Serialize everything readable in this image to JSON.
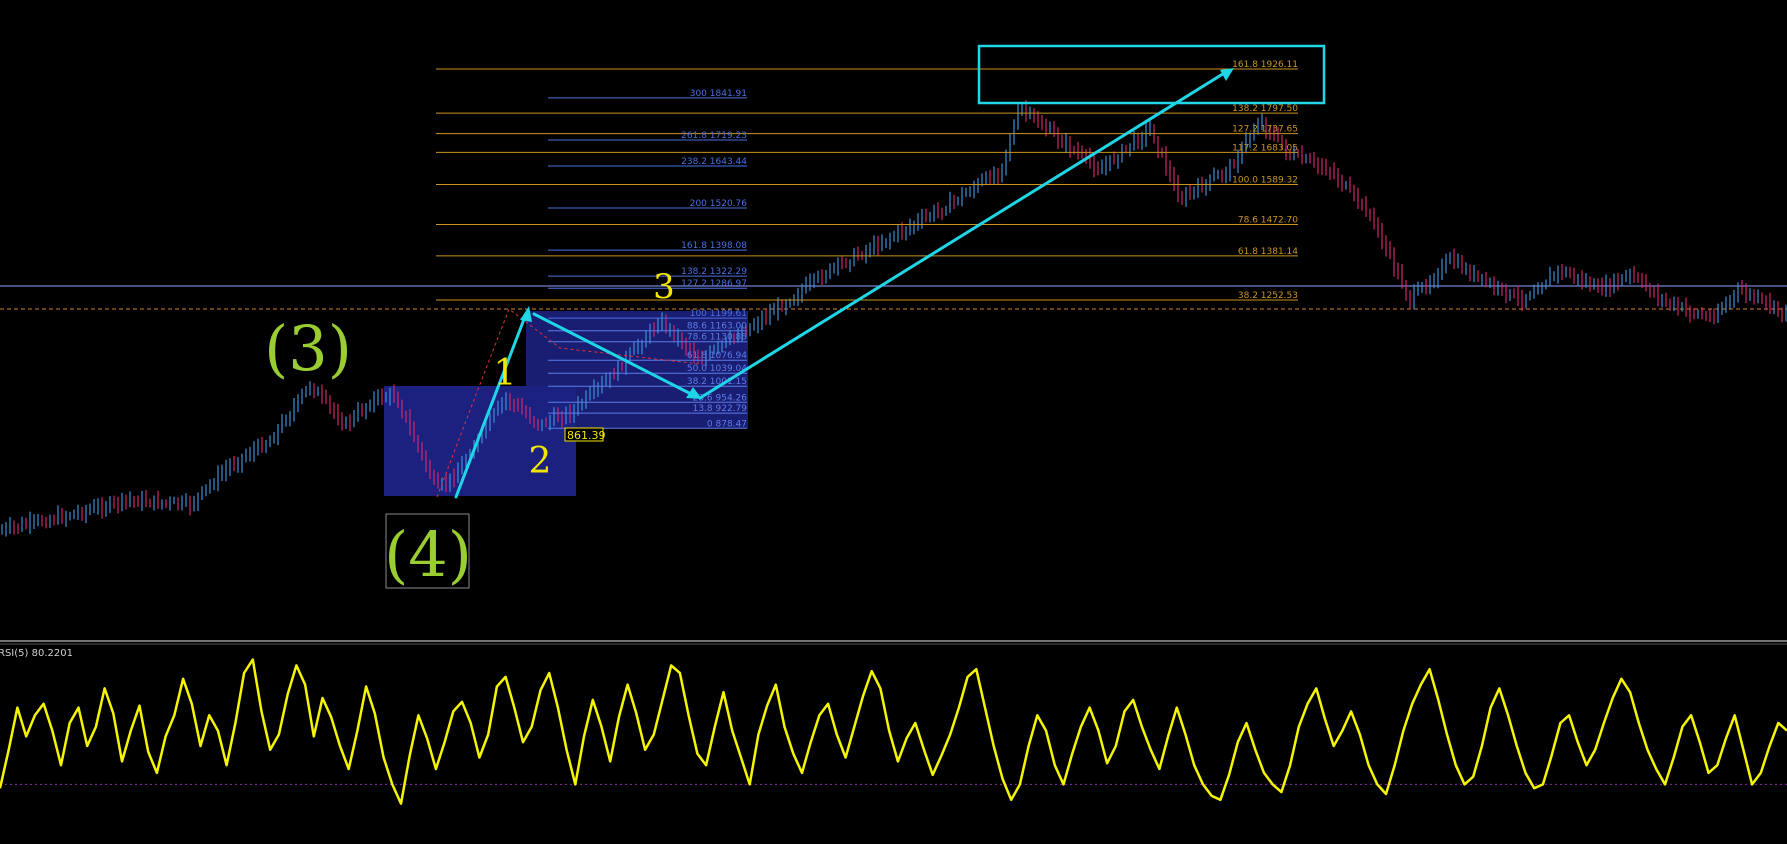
{
  "chart_data": {
    "type": "line",
    "title": "",
    "colors": {
      "background": "#000000",
      "bull_candle": "#3d8fd6",
      "bear_candle": "#d0266c",
      "fib_main": "#c9951e",
      "fib_ext": "#4b6fe0",
      "fib_retr": "#5c7be8",
      "cyan_arrows": "#1fd6e6",
      "wave_major": "#9acd32",
      "wave_minor": "#f2e600",
      "rsi_line": "#f5f500",
      "zone": "#1c2180"
    },
    "price_axis": {
      "visible": false,
      "ylim": [
        640,
        2040
      ]
    },
    "fib_main_levels": [
      {
        "label": "161.8 1926.11",
        "price": 1926.11
      },
      {
        "label": "138.2 1797.50",
        "price": 1797.5
      },
      {
        "label": "127.2 1737.65",
        "price": 1737.65
      },
      {
        "label": "117.2 1683.05",
        "price": 1683.05
      },
      {
        "label": "100.0   1589.32",
        "price": 1589.32
      },
      {
        "label": "78.6 1472.70",
        "price": 1472.7
      },
      {
        "label": "61.8 1381.14",
        "price": 1381.14
      },
      {
        "label": "38.2 1252.53",
        "price": 1252.53
      }
    ],
    "fib_ext_levels": [
      {
        "label": "300 1841.91",
        "price": 1841.91
      },
      {
        "label": "261.8 1719.23",
        "price": 1719.23
      },
      {
        "label": "238.2 1643.44",
        "price": 1643.44
      },
      {
        "label": "200 1520.76",
        "price": 1520.76
      },
      {
        "label": "161.8 1398.08",
        "price": 1398.08
      },
      {
        "label": "138.2 1322.29",
        "price": 1322.29
      },
      {
        "label": "127.2 1286.97",
        "price": 1286.97
      },
      {
        "label": "100 1199.61",
        "price": 1199.61
      }
    ],
    "fib_retr_levels": [
      {
        "label": "88.6 1163.00",
        "price": 1163.0
      },
      {
        "label": "78.6 1130.88",
        "price": 1130.88
      },
      {
        "label": "61.8 1076.94",
        "price": 1076.94
      },
      {
        "label": "50.0 1039.04",
        "price": 1039.04
      },
      {
        "label": "38.2 1001.15",
        "price": 1001.15
      },
      {
        "label": "23.6 954.26",
        "price": 954.26
      },
      {
        "label": "13.8 922.79",
        "price": 922.79
      },
      {
        "label": "0 878.47",
        "price": 878.47
      }
    ],
    "price_tag": "861.39",
    "wave_labels": [
      {
        "text": "(3)",
        "style": "major"
      },
      {
        "text": "(4)",
        "style": "major-boxed"
      },
      {
        "text": "1",
        "style": "minor"
      },
      {
        "text": "2",
        "style": "minor"
      },
      {
        "text": "3",
        "style": "minor"
      }
    ],
    "rsi": {
      "label": "RSI(5) 80.2201",
      "period": 5,
      "last_value": 80.2201,
      "ylim": [
        0,
        100
      ],
      "level": 30,
      "values": [
        28,
        48,
        70,
        55,
        66,
        72,
        58,
        40,
        62,
        70,
        50,
        60,
        80,
        67,
        42,
        58,
        71,
        47,
        36,
        55,
        66,
        85,
        72,
        50,
        66,
        58,
        40,
        62,
        88,
        95,
        68,
        48,
        56,
        77,
        92,
        82,
        55,
        75,
        65,
        50,
        38,
        58,
        81,
        67,
        44,
        30,
        20,
        45,
        66,
        54,
        38,
        52,
        68,
        73,
        62,
        44,
        56,
        81,
        86,
        70,
        52,
        60,
        79,
        88,
        70,
        48,
        30,
        55,
        74,
        60,
        42,
        65,
        82,
        67,
        48,
        56,
        74,
        92,
        88,
        66,
        46,
        40,
        60,
        78,
        58,
        44,
        30,
        56,
        71,
        82,
        60,
        46,
        36,
        52,
        66,
        72,
        56,
        44,
        60,
        76,
        89,
        80,
        58,
        42,
        54,
        62,
        48,
        35,
        45,
        56,
        70,
        86,
        90,
        70,
        50,
        33,
        22,
        30,
        50,
        66,
        58,
        40,
        30,
        46,
        60,
        70,
        58,
        41,
        50,
        68,
        74,
        60,
        48,
        38,
        55,
        70,
        56,
        40,
        30,
        24,
        22,
        35,
        52,
        62,
        48,
        36,
        30,
        26,
        40,
        60,
        72,
        80,
        64,
        50,
        58,
        68,
        56,
        40,
        30,
        25,
        40,
        58,
        72,
        82,
        90,
        74,
        56,
        40,
        30,
        34,
        50,
        70,
        80,
        66,
        50,
        36,
        28,
        30,
        45,
        62,
        66,
        52,
        40,
        48,
        62,
        75,
        85,
        78,
        62,
        48,
        38,
        30,
        44,
        60,
        66,
        52,
        36,
        40,
        54,
        66,
        48,
        30,
        36,
        50,
        62,
        58
      ]
    }
  }
}
